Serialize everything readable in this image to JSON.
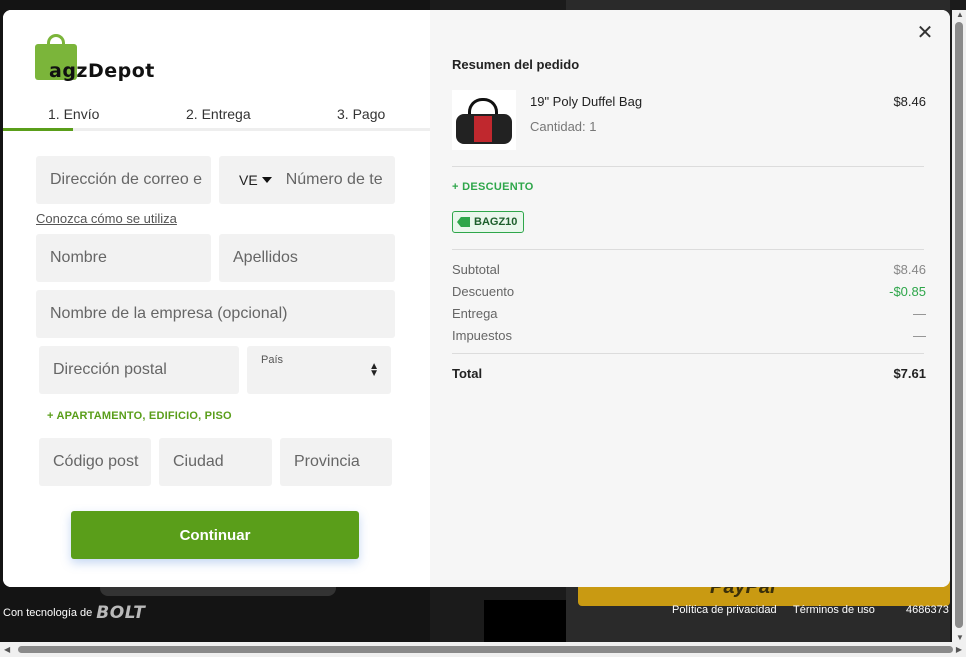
{
  "brand": {
    "name": "BagzDepot",
    "logo_text": "agzDepot"
  },
  "tabs": [
    {
      "label": "1. Envío"
    },
    {
      "label": "2. Entrega"
    },
    {
      "label": "3. Pago"
    }
  ],
  "form": {
    "email_placeholder": "Dirección de correo e",
    "phone_country": "VE",
    "phone_placeholder": "Número de te",
    "learn_link": "Conozca cómo se utiliza",
    "first_name_placeholder": "Nombre",
    "last_name_placeholder": "Apellidos",
    "company_placeholder": "Nombre de la empresa (opcional)",
    "address_placeholder": "Dirección postal",
    "country_label": "País",
    "apartment_link": "+ APARTAMENTO, EDIFICIO, PISO",
    "zip_placeholder": "Código post",
    "city_placeholder": "Ciudad",
    "province_placeholder": "Provincia",
    "continue_label": "Continuar"
  },
  "summary": {
    "title": "Resumen del pedido",
    "product": {
      "name": "19\" Poly Duffel Bag",
      "quantity": "Cantidad: 1",
      "price": "$8.46"
    },
    "discount_link": "+ DESCUENTO",
    "coupon_code": "BAGZ10",
    "rows": [
      {
        "label": "Subtotal",
        "value": "$8.46"
      },
      {
        "label": "Descuento",
        "value": "-$0.85"
      },
      {
        "label": "Entrega",
        "value": "—"
      },
      {
        "label": "Impuestos",
        "value": "—"
      }
    ],
    "total_label": "Total",
    "total_value": "$7.61"
  },
  "footer": {
    "powered_by": "Con tecnología de",
    "bolt": "BOLT",
    "privacy": "Política de privacidad",
    "terms": "Términos de uso",
    "id": "4686373"
  },
  "background": {
    "paypal_text": "PayPal"
  },
  "colors": {
    "accent": "#5a9e1a",
    "discount_green": "#2ea64a"
  }
}
